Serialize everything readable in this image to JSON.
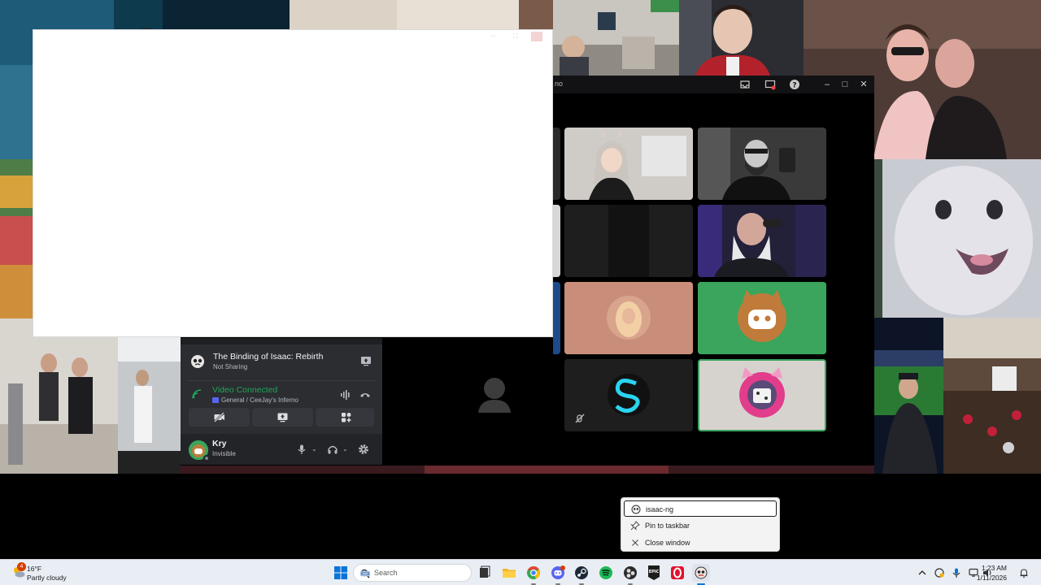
{
  "call_window": {
    "title_fragment": "no",
    "controls": [
      "minimize",
      "maximize",
      "close"
    ]
  },
  "voice_panel": {
    "activity": {
      "title": "The Binding of Isaac: Rebirth",
      "subtitle": "Not Sharing"
    },
    "voice": {
      "status": "Video Connected",
      "channel": "General / CeeJay's Inferno"
    },
    "user": {
      "name": "Kry",
      "status": "Invisible"
    }
  },
  "jump_menu": {
    "app_name": "isaac-ng",
    "items": [
      {
        "label": "Pin to taskbar",
        "icon": "pin-icon"
      },
      {
        "label": "Close window",
        "icon": "close-icon"
      }
    ]
  },
  "taskbar": {
    "weather": {
      "temperature": "16°F",
      "description": "Partly cloudy",
      "badge": "4"
    },
    "search_label": "Search",
    "apps": [
      "start",
      "search",
      "task-view",
      "file-explorer",
      "chrome",
      "discord",
      "steam",
      "spotify",
      "obs",
      "epic-games",
      "opera",
      "isaac"
    ],
    "clock": {
      "time": "1:23 AM",
      "date": "1/11/2026"
    }
  },
  "colors": {
    "discord_green": "#23a559",
    "discord_panel": "#2b2d31",
    "discord_blurple": "#5865f2",
    "taskbar_bg": "#e9eef5"
  }
}
